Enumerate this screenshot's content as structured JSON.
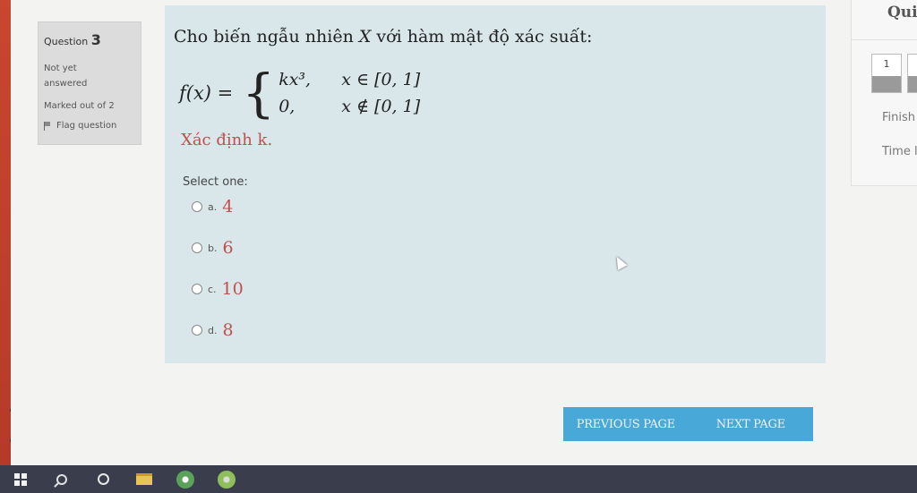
{
  "question": {
    "label": "Question",
    "number": "3",
    "status": "Not yet answered",
    "marked": "Marked out of 2",
    "flag": "Flag question",
    "text_prefix": "Cho biến ngẫu nhiên ",
    "text_var": "X",
    "text_suffix": " với hàm mật độ xác suất:",
    "formula": {
      "lhs": "f(x) =",
      "case1_value": "kx³,",
      "case1_cond": "x ∈ [0, 1]",
      "case2_value": "0,",
      "case2_cond": "x ∉ [0, 1]"
    },
    "determine": "Xác định k."
  },
  "answer": {
    "prompt": "Select one:",
    "options": [
      {
        "letter": "a.",
        "value": "4"
      },
      {
        "letter": "b.",
        "value": "6"
      },
      {
        "letter": "c.",
        "value": "10"
      },
      {
        "letter": "d.",
        "value": "8"
      }
    ]
  },
  "quiz_nav": {
    "title": "Quiz",
    "buttons": [
      {
        "label": "1"
      },
      {
        "label": ""
      }
    ],
    "finish": "Finish a",
    "time_left": "Time le"
  },
  "navigation": {
    "previous": "PREVIOUS PAGE",
    "next": "NEXT PAGE"
  },
  "taskbar": {
    "icons": [
      "windows-start-icon",
      "search-icon",
      "cortana-icon",
      "file-explorer-icon",
      "chrome-icon",
      "chrome-alt-icon"
    ]
  },
  "colors": {
    "accent": "#48a9d8",
    "answer_text": "#c0504d",
    "content_bg": "#d9e6ea",
    "taskbar": "#3a3d4c"
  }
}
